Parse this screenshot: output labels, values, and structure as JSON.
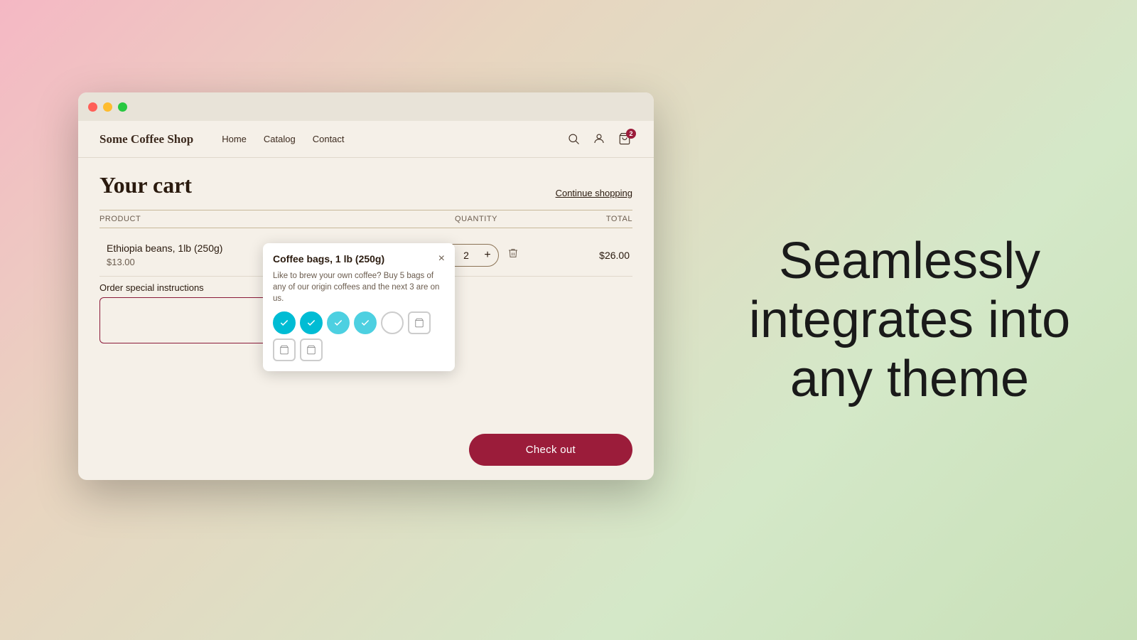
{
  "background": {
    "gradient": "linear-gradient(135deg, #f5b8c4 0%, #e8d5c0 30%, #d4e8c8 70%, #c8e0b8 100%)"
  },
  "browser": {
    "title_bar": {
      "buttons": [
        "red",
        "yellow",
        "green"
      ]
    }
  },
  "nav": {
    "brand": "Some Coffee Shop",
    "links": [
      "Home",
      "Catalog",
      "Contact"
    ],
    "cart_count": "2"
  },
  "page": {
    "title": "Your cart",
    "continue_shopping": "Continue shopping"
  },
  "table": {
    "headers": [
      "PRODUCT",
      "QUANTITY",
      "TOTAL"
    ]
  },
  "cart_item": {
    "name": "Ethiopia beans, 1lb (250g)",
    "unit_price": "$13.00",
    "quantity": "2",
    "total": "$26.00"
  },
  "tooltip": {
    "title": "Coffee bags, 1 lb (250g)",
    "description": "Like to brew your own coffee? Buy 5 bags of any of our origin coffees and the next 3 are on us.",
    "close_label": "×",
    "items": [
      {
        "type": "checked-teal"
      },
      {
        "type": "checked-teal"
      },
      {
        "type": "checked-cyan"
      },
      {
        "type": "checked-cyan"
      },
      {
        "type": "empty"
      },
      {
        "type": "bag"
      },
      {
        "type": "bag"
      },
      {
        "type": "bag"
      }
    ]
  },
  "order_instructions": {
    "label": "Order special instructions",
    "placeholder": ""
  },
  "checkout": {
    "button_label": "Check out"
  },
  "right_panel": {
    "line1": "Seamlessly",
    "line2": "integrates into",
    "line3": "any theme"
  }
}
